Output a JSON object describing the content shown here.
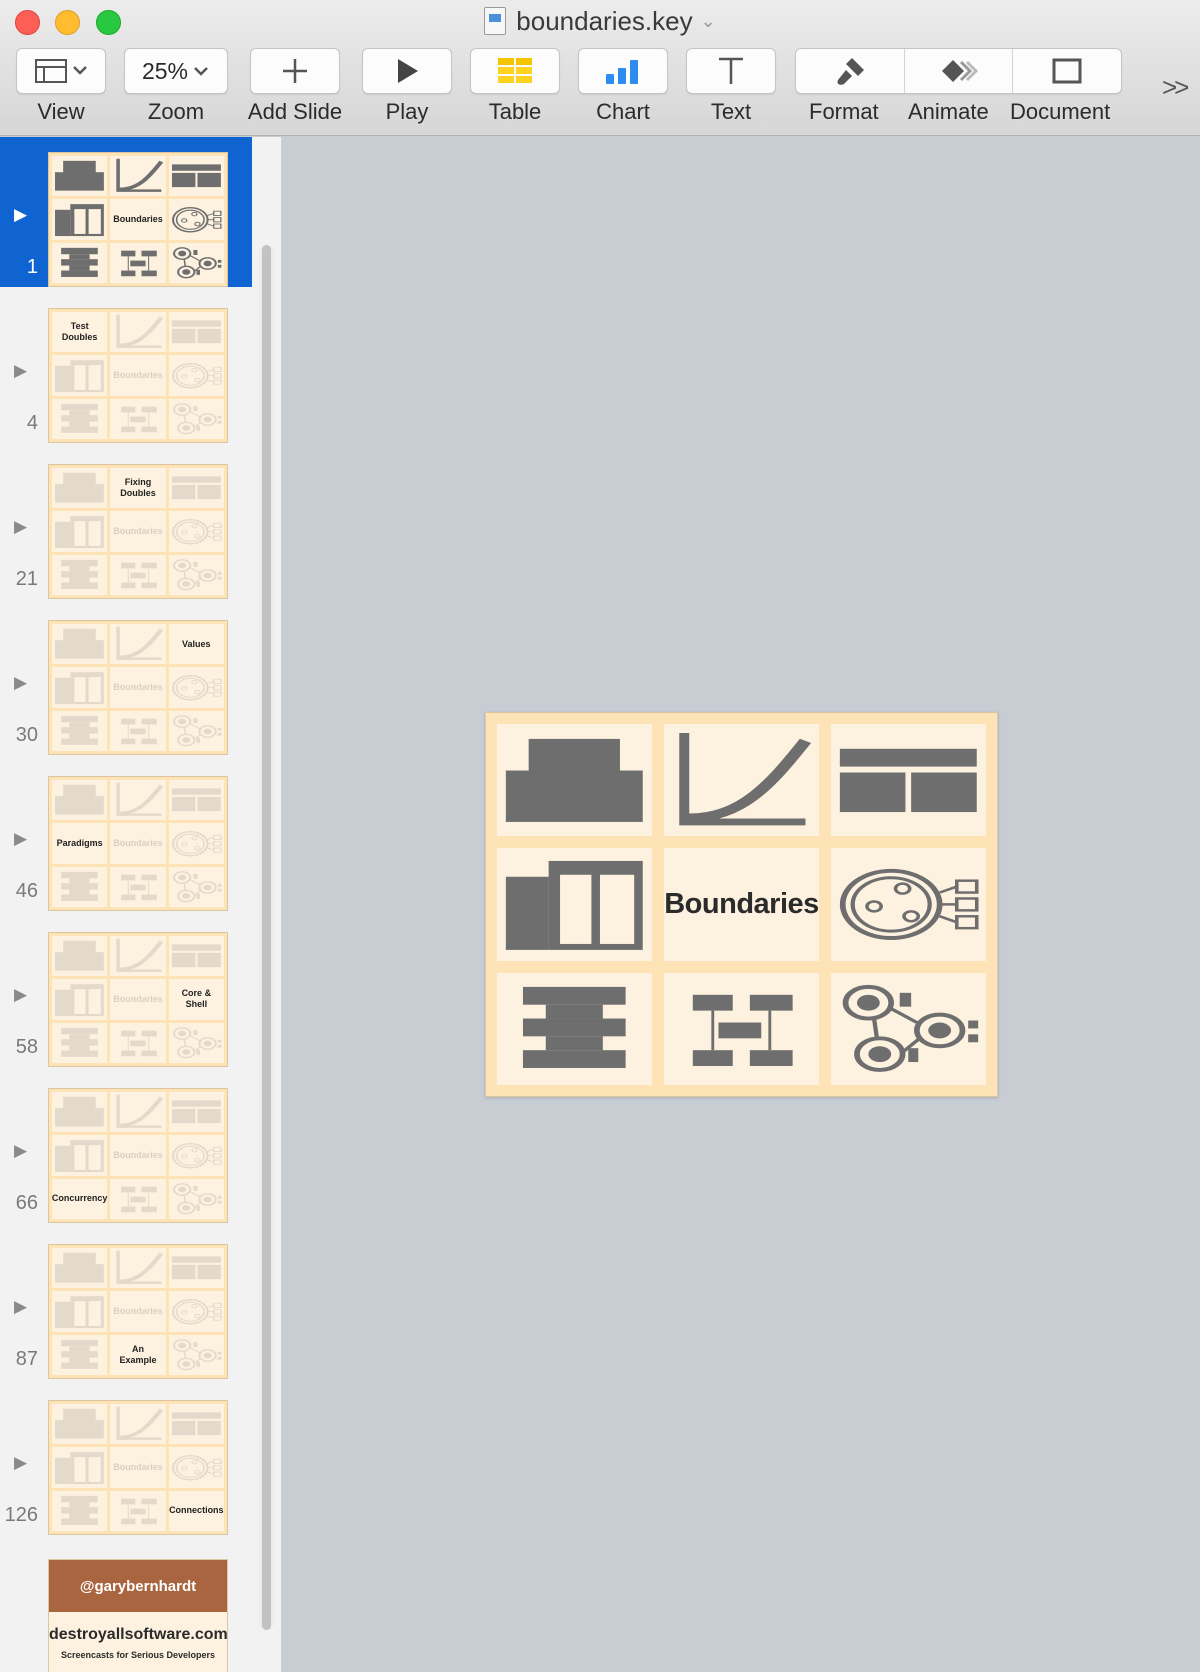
{
  "window": {
    "title": "boundaries.key"
  },
  "toolbar": {
    "view": "View",
    "zoom_value": "25%",
    "zoom": "Zoom",
    "add_slide": "Add Slide",
    "play": "Play",
    "table": "Table",
    "chart": "Chart",
    "text": "Text",
    "format": "Format",
    "animate": "Animate",
    "document": "Document"
  },
  "slides": [
    {
      "number": "1",
      "selected": true,
      "labels": [
        "",
        "",
        "",
        "",
        "Boundaries",
        "",
        "",
        "",
        ""
      ]
    },
    {
      "number": "4",
      "labels": [
        "Test\nDoubles",
        "",
        "",
        "",
        "Boundaries",
        "",
        "",
        "",
        ""
      ]
    },
    {
      "number": "21",
      "labels": [
        "",
        "Fixing\nDoubles",
        "",
        "",
        "Boundaries",
        "",
        "",
        "",
        ""
      ]
    },
    {
      "number": "30",
      "labels": [
        "",
        "",
        "Values",
        "",
        "Boundaries",
        "",
        "",
        "",
        ""
      ]
    },
    {
      "number": "46",
      "labels": [
        "",
        "",
        "",
        "Paradigms",
        "Boundaries",
        "",
        "",
        "",
        ""
      ]
    },
    {
      "number": "58",
      "labels": [
        "",
        "",
        "",
        "",
        "Boundaries",
        "Core &\nShell",
        "",
        "",
        ""
      ]
    },
    {
      "number": "66",
      "labels": [
        "",
        "",
        "",
        "",
        "Boundaries",
        "",
        "Concurrency",
        "",
        ""
      ]
    },
    {
      "number": "87",
      "labels": [
        "",
        "",
        "",
        "",
        "Boundaries",
        "",
        "",
        "An\nExample",
        ""
      ]
    },
    {
      "number": "126",
      "labels": [
        "",
        "",
        "",
        "",
        "Boundaries",
        "",
        "",
        "",
        "Connections"
      ]
    }
  ],
  "promo_slide": {
    "handle": "@garybernhardt",
    "site": "destroyallsoftware.com",
    "tagline": "Screencasts for Serious Developers"
  },
  "main_slide": {
    "title": "Boundaries"
  },
  "colors": {
    "slide_bg": "#fde3b5",
    "cell_bg": "#fdf1e0",
    "icon_gray": "#6e6e6e",
    "selection": "#0f64d2",
    "promo_header": "#a86540"
  }
}
